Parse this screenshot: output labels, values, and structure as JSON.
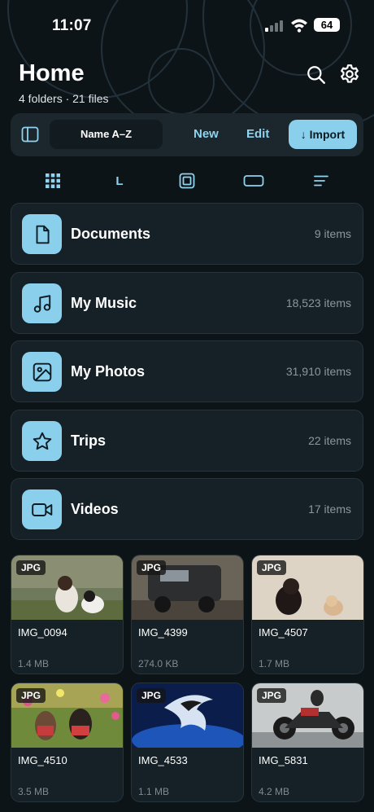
{
  "status": {
    "time": "11:07",
    "battery": "64"
  },
  "header": {
    "title": "Home",
    "subtitle": "4 folders · 21 files"
  },
  "toolbar": {
    "sort": "Name A–Z",
    "new_label": "New",
    "edit_label": "Edit",
    "import_label": "↓ Import"
  },
  "view_switcher": {
    "list_label": "L"
  },
  "folders": [
    {
      "name": "Documents",
      "count": "9 items",
      "icon": "document-icon"
    },
    {
      "name": "My Music",
      "count": "18,523 items",
      "icon": "music-note-icon"
    },
    {
      "name": "My Photos",
      "count": "31,910 items",
      "icon": "photo-icon"
    },
    {
      "name": "Trips",
      "count": "22 items",
      "icon": "star-icon"
    },
    {
      "name": "Videos",
      "count": "17 items",
      "icon": "video-camera-icon"
    }
  ],
  "files": [
    {
      "badge": "JPG",
      "name": "IMG_0094",
      "size": "1.4 MB"
    },
    {
      "badge": "JPG",
      "name": "IMG_4399",
      "size": "274.0 KB"
    },
    {
      "badge": "JPG",
      "name": "IMG_4507",
      "size": "1.7 MB"
    },
    {
      "badge": "JPG",
      "name": "IMG_4510",
      "size": "3.5 MB"
    },
    {
      "badge": "JPG",
      "name": "IMG_4533",
      "size": "1.1 MB"
    },
    {
      "badge": "JPG",
      "name": "IMG_5831",
      "size": "4.2 MB"
    }
  ],
  "colors": {
    "accent": "#8ad0ec",
    "background": "#0d1418",
    "card": "#152027"
  }
}
